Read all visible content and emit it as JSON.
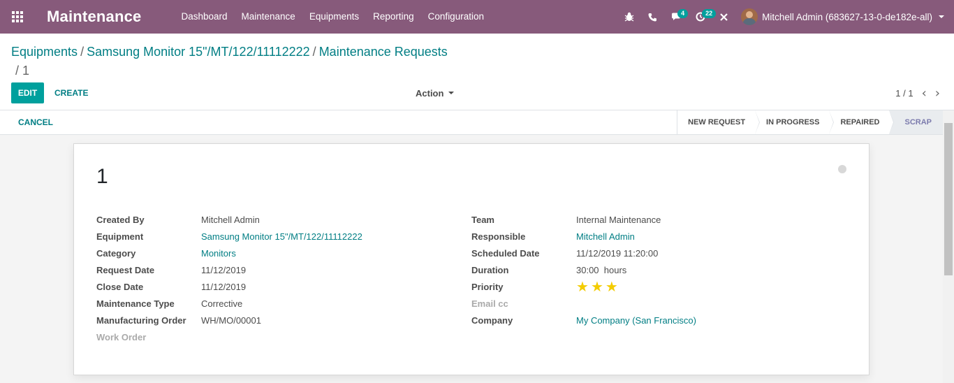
{
  "navbar": {
    "app_title": "Maintenance",
    "menu": [
      "Dashboard",
      "Maintenance",
      "Equipments",
      "Reporting",
      "Configuration"
    ],
    "messages_count": "4",
    "activities_count": "22",
    "user_name": "Mitchell Admin (683627-13-0-de182e-all)"
  },
  "breadcrumb": {
    "items": [
      "Equipments",
      "Samsung Monitor 15\"/MT/122/11112222",
      "Maintenance Requests"
    ],
    "current": "1"
  },
  "buttons": {
    "edit": "EDIT",
    "create": "CREATE",
    "action": "Action",
    "cancel": "CANCEL"
  },
  "pager": {
    "value": "1 / 1"
  },
  "stages": [
    "NEW REQUEST",
    "IN PROGRESS",
    "REPAIRED",
    "SCRAP"
  ],
  "record": {
    "name": "1",
    "left_fields": [
      {
        "label": "Created By",
        "value": "Mitchell Admin"
      },
      {
        "label": "Equipment",
        "value": "Samsung Monitor 15\"/MT/122/11112222"
      },
      {
        "label": "Category",
        "value": "Monitors"
      },
      {
        "label": "Request Date",
        "value": "11/12/2019"
      },
      {
        "label": "Close Date",
        "value": "11/12/2019"
      },
      {
        "label": "Maintenance Type",
        "value": "Corrective"
      },
      {
        "label": "Manufacturing Order",
        "value": "WH/MO/00001"
      },
      {
        "label": "Work Order",
        "value": ""
      }
    ],
    "right_fields": [
      {
        "label": "Team",
        "value": "Internal Maintenance"
      },
      {
        "label": "Responsible",
        "value": "Mitchell Admin"
      },
      {
        "label": "Scheduled Date",
        "value": "11/12/2019 11:20:00"
      },
      {
        "label": "Duration",
        "value": "30:00  hours"
      },
      {
        "label": "Priority",
        "value": "3"
      },
      {
        "label": "Email cc",
        "value": ""
      },
      {
        "label": "Company",
        "value": "My Company (San Francisco)"
      }
    ]
  },
  "colors": {
    "brand": "#875a7b",
    "accent": "#00a09d",
    "link": "#017e84",
    "star": "#f3cc00"
  },
  "icons": [
    "apps-grid-icon",
    "bug-icon",
    "phone-icon",
    "chat-icon",
    "clock-icon",
    "close-icon",
    "chevron-left-icon",
    "chevron-right-icon"
  ]
}
